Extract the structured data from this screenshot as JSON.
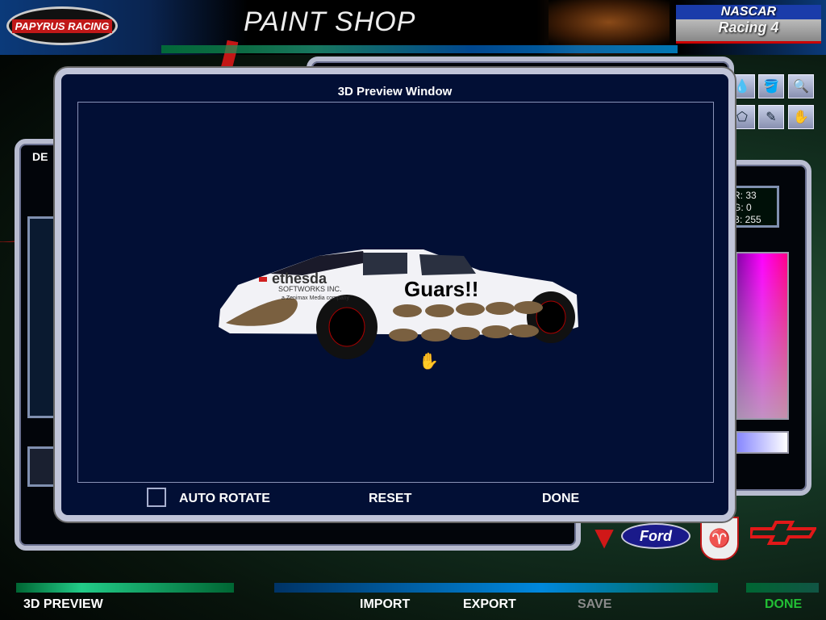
{
  "header": {
    "title": "PAINT SHOP",
    "left_logo": "PAPYRUS RACING",
    "right_logo": {
      "line1": "NASCAR",
      "line2": "Racing 4"
    }
  },
  "tools": [
    {
      "icon": "water-drop-icon"
    },
    {
      "icon": "paint-bucket-icon"
    },
    {
      "icon": "magnifier-icon"
    },
    {
      "icon": "pentagon-icon"
    },
    {
      "icon": "eyedropper-icon"
    },
    {
      "icon": "hand-icon"
    }
  ],
  "left_panel": {
    "title": "DE"
  },
  "color": {
    "r_label": "R: 33",
    "g_label": "G: 0",
    "b_label": "B: 255"
  },
  "manufacturers": [
    "Pontiac",
    "Ford",
    "Dodge",
    "Chevrolet"
  ],
  "preview": {
    "title": "3D Preview Window",
    "car": {
      "number_text": "Guars!!",
      "sponsor_line1": "ethesda",
      "sponsor_line2": "SOFTWORKS INC.",
      "sponsor_line3": "a Zenimax Media company"
    },
    "auto_rotate_label": "AUTO ROTATE",
    "auto_rotate_checked": false,
    "reset_label": "RESET",
    "done_label": "DONE"
  },
  "footer": {
    "preview": "3D PREVIEW",
    "import": "IMPORT",
    "export": "EXPORT",
    "save": "SAVE",
    "done": "DONE"
  },
  "colors": {
    "done": "#22c035",
    "save_disabled": "#8a8a8a"
  }
}
